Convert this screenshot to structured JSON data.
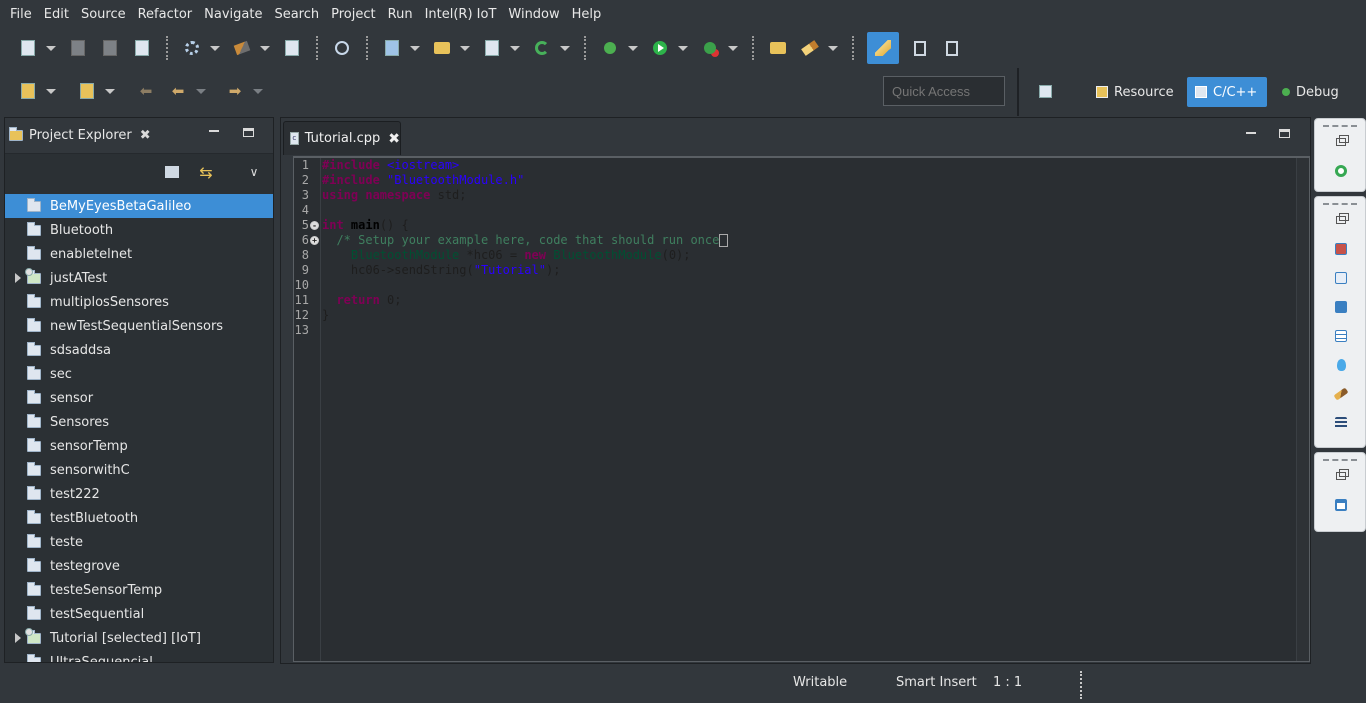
{
  "menu": [
    "File",
    "Edit",
    "Source",
    "Refactor",
    "Navigate",
    "Search",
    "Project",
    "Run",
    "Intel(R) IoT",
    "Window",
    "Help"
  ],
  "quick_access": {
    "placeholder": "Quick Access"
  },
  "perspectives": {
    "resource": "Resource",
    "cpp": "C/C++",
    "debug": "Debug"
  },
  "project_explorer": {
    "title": "Project Explorer",
    "items": [
      {
        "label": "BeMyEyesBetaGalileo",
        "selected": true,
        "expandable": false,
        "iot": false
      },
      {
        "label": "Bluetooth",
        "selected": false,
        "expandable": false,
        "iot": false
      },
      {
        "label": "enabletelnet",
        "selected": false,
        "expandable": false,
        "iot": false
      },
      {
        "label": "justATest",
        "selected": false,
        "expandable": true,
        "iot": true
      },
      {
        "label": "multiplosSensores",
        "selected": false,
        "expandable": false,
        "iot": false
      },
      {
        "label": "newTestSequentialSensors",
        "selected": false,
        "expandable": false,
        "iot": false
      },
      {
        "label": "sdsaddsa",
        "selected": false,
        "expandable": false,
        "iot": false
      },
      {
        "label": "sec",
        "selected": false,
        "expandable": false,
        "iot": false
      },
      {
        "label": "sensor",
        "selected": false,
        "expandable": false,
        "iot": false
      },
      {
        "label": "Sensores",
        "selected": false,
        "expandable": false,
        "iot": false
      },
      {
        "label": "sensorTemp",
        "selected": false,
        "expandable": false,
        "iot": false
      },
      {
        "label": "sensorwithC",
        "selected": false,
        "expandable": false,
        "iot": false
      },
      {
        "label": "test222",
        "selected": false,
        "expandable": false,
        "iot": false
      },
      {
        "label": "testBluetooth",
        "selected": false,
        "expandable": false,
        "iot": false
      },
      {
        "label": "teste",
        "selected": false,
        "expandable": false,
        "iot": false
      },
      {
        "label": "testegrove",
        "selected": false,
        "expandable": false,
        "iot": false
      },
      {
        "label": "testeSensorTemp",
        "selected": false,
        "expandable": false,
        "iot": false
      },
      {
        "label": "testSequential",
        "selected": false,
        "expandable": false,
        "iot": false
      },
      {
        "label": "Tutorial [selected] [IoT]",
        "selected": false,
        "expandable": true,
        "iot": true
      },
      {
        "label": "UltraSequencial",
        "selected": false,
        "expandable": false,
        "iot": false
      }
    ]
  },
  "editor": {
    "tab_label": "Tutorial.cpp",
    "line_numbers": [
      "1",
      "2",
      "3",
      "4",
      "5",
      "6",
      "8",
      "9",
      "10",
      "11",
      "12",
      "13"
    ],
    "fold_markers": {
      "5": "-",
      "6": "+"
    },
    "lines": [
      [
        {
          "t": "#include ",
          "c": "kw"
        },
        {
          "t": "<iostream>",
          "c": "str"
        }
      ],
      [
        {
          "t": "#include ",
          "c": "kw"
        },
        {
          "t": "\"BluetoothModule.h\"",
          "c": "str"
        }
      ],
      [
        {
          "t": "using namespace ",
          "c": "kw"
        },
        {
          "t": "std;",
          "c": "plain"
        }
      ],
      [],
      [
        {
          "t": "int ",
          "c": "kw"
        },
        {
          "t": "main",
          "c": "fn"
        },
        {
          "t": "() {",
          "c": "plain"
        }
      ],
      [
        {
          "t": "  /* Setup your example here, code that should run once",
          "c": "cmt"
        }
      ],
      [
        {
          "t": "    ",
          "c": "plain"
        },
        {
          "t": "BluetoothModule",
          "c": "type"
        },
        {
          "t": " *hc06 = ",
          "c": "plain"
        },
        {
          "t": "new ",
          "c": "kw"
        },
        {
          "t": "BluetoothModule",
          "c": "type"
        },
        {
          "t": "(0);",
          "c": "plain"
        }
      ],
      [
        {
          "t": "    hc06->sendString(",
          "c": "plain"
        },
        {
          "t": "\"Tutorial\"",
          "c": "str"
        },
        {
          "t": ");",
          "c": "plain"
        }
      ],
      [],
      [
        {
          "t": "  ",
          "c": "plain"
        },
        {
          "t": "return ",
          "c": "kw"
        },
        {
          "t": "0;",
          "c": "plain"
        }
      ],
      [
        {
          "t": "}",
          "c": "plain"
        }
      ],
      []
    ]
  },
  "status": {
    "writable": "Writable",
    "insert_mode": "Smart Insert",
    "position": "1 : 1"
  }
}
